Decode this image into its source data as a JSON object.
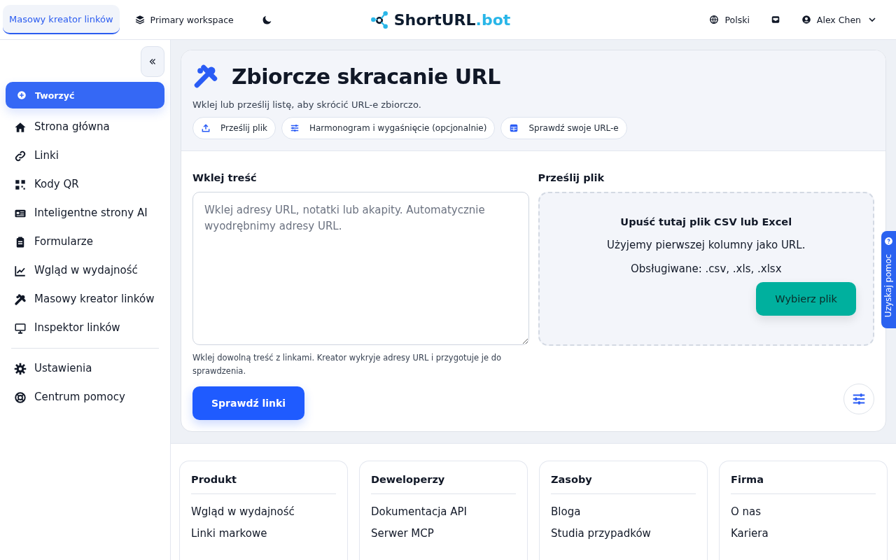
{
  "topbar": {
    "tabs": [
      {
        "label": "Masowy kreator linków",
        "selected": true
      }
    ],
    "workspace": "Primary workspace",
    "dark_mode": false,
    "brand": {
      "name": "ShortURL",
      "suffix": ".bot"
    },
    "language": "Polski",
    "user": "Alex Chen"
  },
  "sidebar": {
    "create": "Tworzyć",
    "items": [
      {
        "label": "Strona główna",
        "selected": false
      },
      {
        "label": "Linki",
        "selected": false
      },
      {
        "label": "Kody QR",
        "selected": false
      },
      {
        "label": "Inteligentne strony AI",
        "selected": false
      },
      {
        "label": "Formularze",
        "selected": false
      },
      {
        "label": "Wgląd w wydajność",
        "selected": false
      },
      {
        "label": "Masowy kreator linków",
        "selected": false
      },
      {
        "label": "Inspektor linków",
        "selected": false
      }
    ],
    "bottom_items": [
      {
        "label": "Ustawienia",
        "selected": false
      },
      {
        "label": "Centrum pomocy",
        "selected": false
      }
    ]
  },
  "page": {
    "title": "Zbiorcze skracanie URL",
    "subtitle": "Wklej lub prześlij listę, aby skrócić URL-e zbiorczo.",
    "steps": [
      {
        "label": "Prześlij plik"
      },
      {
        "label": "Harmonogram i wygaśnięcie (opcjonalnie)"
      },
      {
        "label": "Sprawdź swoje URL-e"
      }
    ],
    "paste": {
      "label": "Wklej treść",
      "placeholder": "Wklej adresy URL, notatki lub akapity. Automatycznie wyodrębnimy adresy URL.",
      "hint": "Wklej dowolną treść z linkami. Kreator wykryje adresy URL i przygotuje je do sprawdzenia.",
      "button": "Sprawdź linki"
    },
    "upload": {
      "label": "Prześlij plik",
      "title": "Upuść tutaj plik CSV lub Excel",
      "lines": [
        "Użyjemy pierwszej kolumny jako URL.",
        "Obsługiwane: .csv, .xls, .xlsx"
      ],
      "button": "Wybierz plik"
    }
  },
  "help_tab": "Uzyskaj pomoc",
  "footer": {
    "columns": [
      {
        "title": "Produkt",
        "links": [
          "Wgląd w wydajność",
          "Linki markowe"
        ]
      },
      {
        "title": "Deweloperzy",
        "links": [
          "Dokumentacja API",
          "Serwer MCP"
        ]
      },
      {
        "title": "Zasoby",
        "links": [
          "Bloga",
          "Studia przypadków"
        ]
      },
      {
        "title": "Firma",
        "links": [
          "O nas",
          "Kariera"
        ]
      }
    ]
  }
}
